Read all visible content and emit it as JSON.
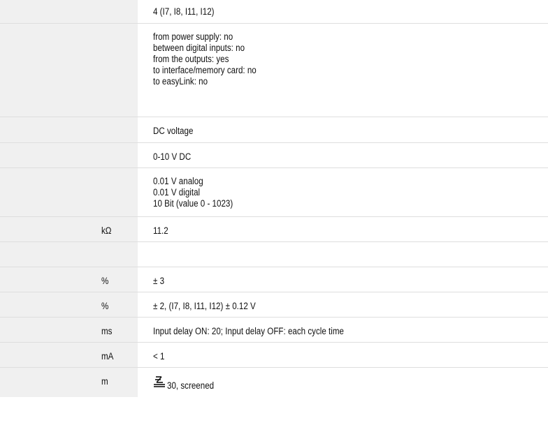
{
  "rows": [
    {
      "unit": "",
      "lines": [
        "4 (I7, I8, I11, I12)"
      ]
    },
    {
      "unit": "",
      "lines": [
        "from power supply: no",
        "between digital inputs: no",
        "from the outputs: yes",
        "to interface/memory card: no",
        "to easyLink: no"
      ]
    },
    {
      "unit": "",
      "lines": [
        "DC voltage"
      ]
    },
    {
      "unit": "",
      "lines": [
        "0-10 V DC"
      ]
    },
    {
      "unit": "",
      "lines": [
        "0.01 V analog",
        "0.01 V digital",
        "10 Bit (value 0 - 1023)"
      ]
    },
    {
      "unit": "kΩ",
      "lines": [
        "11.2"
      ]
    },
    {
      "unit": "",
      "lines": []
    },
    {
      "unit": "%",
      "lines": [
        "± 3"
      ]
    },
    {
      "unit": "%",
      "lines": [
        "± 2, (I7, I8, I11, I12) ± 0.12 V"
      ]
    },
    {
      "unit": "ms",
      "lines": [
        "Input delay ON: 20; Input delay OFF: each cycle time"
      ]
    },
    {
      "unit": "mA",
      "lines": [
        "< 1"
      ]
    },
    {
      "unit": "m",
      "lines": [],
      "icon": "shielded-cable-icon",
      "cable_text": "30, screened"
    }
  ]
}
